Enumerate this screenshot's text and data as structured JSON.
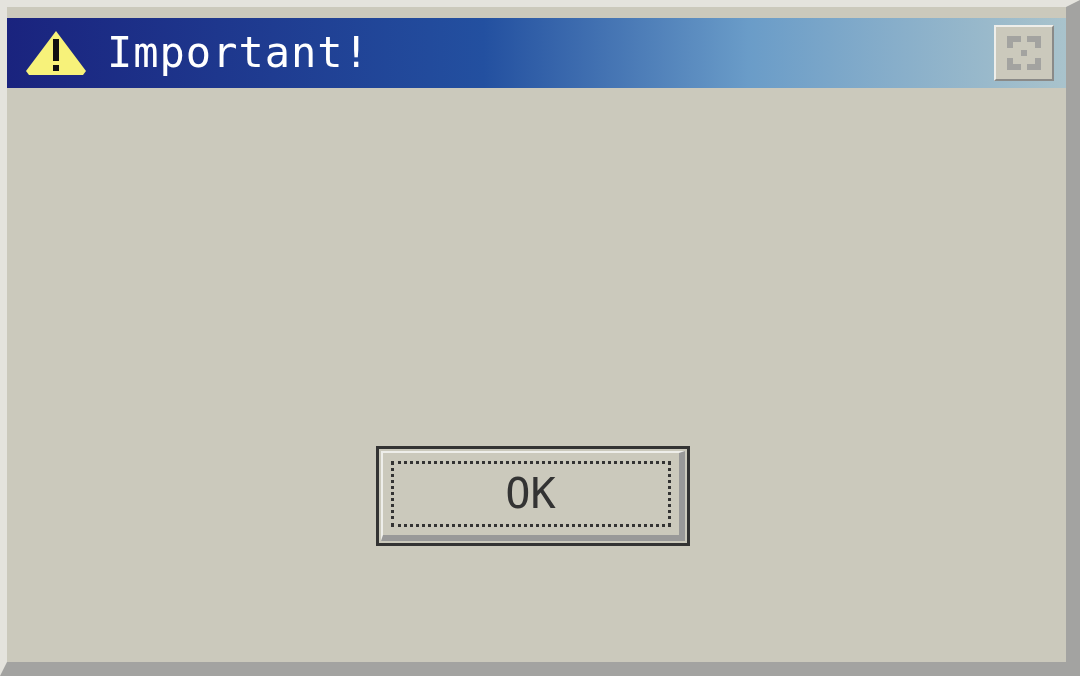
{
  "window": {
    "title": "Important!",
    "close_button": {
      "disabled": true
    }
  },
  "buttons": [
    {
      "label": "OK",
      "focused": true
    }
  ]
}
